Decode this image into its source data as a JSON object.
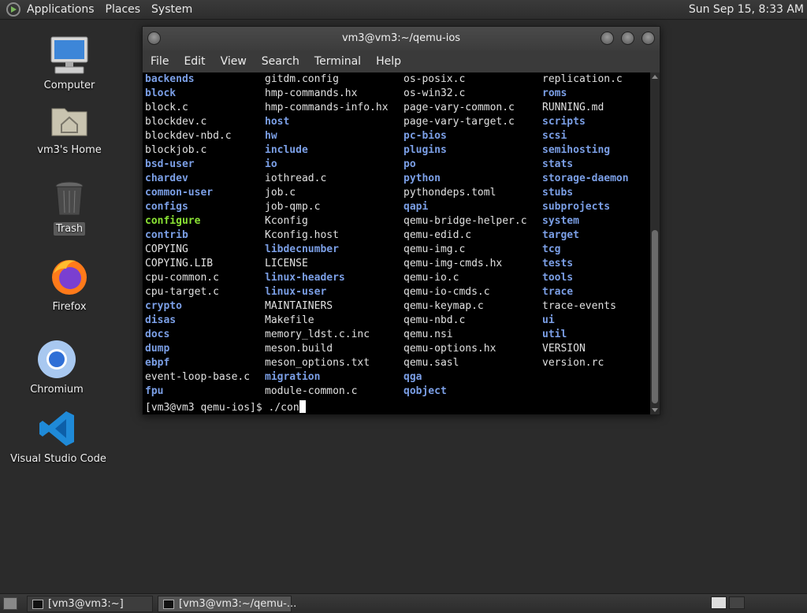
{
  "top_panel": {
    "menus": [
      "Applications",
      "Places",
      "System"
    ],
    "clock": "Sun Sep 15,  8:33 AM"
  },
  "desktop_icons": [
    {
      "label": "Computer",
      "icon": "computer-icon"
    },
    {
      "label": "vm3's Home",
      "icon": "home-folder-icon"
    },
    {
      "label": "Trash",
      "icon": "trash-icon"
    },
    {
      "label": "Firefox",
      "icon": "firefox-icon"
    },
    {
      "label": "Chromium",
      "icon": "chromium-icon"
    },
    {
      "label": "Visual Studio Code",
      "icon": "vscode-icon"
    }
  ],
  "terminal": {
    "title": "vm3@vm3:~/qemu-ios",
    "menus": [
      "File",
      "Edit",
      "View",
      "Search",
      "Terminal",
      "Help"
    ],
    "colors": {
      "directory": "#7b9fe6",
      "executable": "#8ae234",
      "file": "#e0e0e0"
    },
    "listing": [
      [
        [
          "backends",
          "d"
        ],
        [
          "gitdm.config",
          "f"
        ],
        [
          "os-posix.c",
          "f"
        ],
        [
          "replication.c",
          "f"
        ]
      ],
      [
        [
          "block",
          "d"
        ],
        [
          "hmp-commands.hx",
          "f"
        ],
        [
          "os-win32.c",
          "f"
        ],
        [
          "roms",
          "d"
        ]
      ],
      [
        [
          "block.c",
          "f"
        ],
        [
          "hmp-commands-info.hx",
          "f"
        ],
        [
          "page-vary-common.c",
          "f"
        ],
        [
          "RUNNING.md",
          "f"
        ]
      ],
      [
        [
          "blockdev.c",
          "f"
        ],
        [
          "host",
          "d"
        ],
        [
          "page-vary-target.c",
          "f"
        ],
        [
          "scripts",
          "d"
        ]
      ],
      [
        [
          "blockdev-nbd.c",
          "f"
        ],
        [
          "hw",
          "d"
        ],
        [
          "pc-bios",
          "d"
        ],
        [
          "scsi",
          "d"
        ]
      ],
      [
        [
          "blockjob.c",
          "f"
        ],
        [
          "include",
          "d"
        ],
        [
          "plugins",
          "d"
        ],
        [
          "semihosting",
          "d"
        ]
      ],
      [
        [
          "bsd-user",
          "d"
        ],
        [
          "io",
          "d"
        ],
        [
          "po",
          "d"
        ],
        [
          "stats",
          "d"
        ]
      ],
      [
        [
          "chardev",
          "d"
        ],
        [
          "iothread.c",
          "f"
        ],
        [
          "python",
          "d"
        ],
        [
          "storage-daemon",
          "d"
        ]
      ],
      [
        [
          "common-user",
          "d"
        ],
        [
          "job.c",
          "f"
        ],
        [
          "pythondeps.toml",
          "f"
        ],
        [
          "stubs",
          "d"
        ]
      ],
      [
        [
          "configs",
          "d"
        ],
        [
          "job-qmp.c",
          "f"
        ],
        [
          "qapi",
          "d"
        ],
        [
          "subprojects",
          "d"
        ]
      ],
      [
        [
          "configure",
          "x"
        ],
        [
          "Kconfig",
          "f"
        ],
        [
          "qemu-bridge-helper.c",
          "f"
        ],
        [
          "system",
          "d"
        ]
      ],
      [
        [
          "contrib",
          "d"
        ],
        [
          "Kconfig.host",
          "f"
        ],
        [
          "qemu-edid.c",
          "f"
        ],
        [
          "target",
          "d"
        ]
      ],
      [
        [
          "COPYING",
          "f"
        ],
        [
          "libdecnumber",
          "d"
        ],
        [
          "qemu-img.c",
          "f"
        ],
        [
          "tcg",
          "d"
        ]
      ],
      [
        [
          "COPYING.LIB",
          "f"
        ],
        [
          "LICENSE",
          "f"
        ],
        [
          "qemu-img-cmds.hx",
          "f"
        ],
        [
          "tests",
          "d"
        ]
      ],
      [
        [
          "cpu-common.c",
          "f"
        ],
        [
          "linux-headers",
          "d"
        ],
        [
          "qemu-io.c",
          "f"
        ],
        [
          "tools",
          "d"
        ]
      ],
      [
        [
          "cpu-target.c",
          "f"
        ],
        [
          "linux-user",
          "d"
        ],
        [
          "qemu-io-cmds.c",
          "f"
        ],
        [
          "trace",
          "d"
        ]
      ],
      [
        [
          "crypto",
          "d"
        ],
        [
          "MAINTAINERS",
          "f"
        ],
        [
          "qemu-keymap.c",
          "f"
        ],
        [
          "trace-events",
          "f"
        ]
      ],
      [
        [
          "disas",
          "d"
        ],
        [
          "Makefile",
          "f"
        ],
        [
          "qemu-nbd.c",
          "f"
        ],
        [
          "ui",
          "d"
        ]
      ],
      [
        [
          "docs",
          "d"
        ],
        [
          "memory_ldst.c.inc",
          "f"
        ],
        [
          "qemu.nsi",
          "f"
        ],
        [
          "util",
          "d"
        ]
      ],
      [
        [
          "dump",
          "d"
        ],
        [
          "meson.build",
          "f"
        ],
        [
          "qemu-options.hx",
          "f"
        ],
        [
          "VERSION",
          "f"
        ]
      ],
      [
        [
          "ebpf",
          "d"
        ],
        [
          "meson_options.txt",
          "f"
        ],
        [
          "qemu.sasl",
          "f"
        ],
        [
          "version.rc",
          "f"
        ]
      ],
      [
        [
          "event-loop-base.c",
          "f"
        ],
        [
          "migration",
          "d"
        ],
        [
          "qga",
          "d"
        ],
        [
          "",
          ""
        ]
      ],
      [
        [
          "fpu",
          "d"
        ],
        [
          "module-common.c",
          "f"
        ],
        [
          "qobject",
          "d"
        ],
        [
          "",
          ""
        ]
      ]
    ],
    "prompt": "[vm3@vm3 qemu-ios]$ ./con"
  },
  "taskbar": {
    "tasks": [
      {
        "label": "[vm3@vm3:~]",
        "active": false
      },
      {
        "label": "[vm3@vm3:~/qemu-...",
        "active": true
      }
    ]
  }
}
